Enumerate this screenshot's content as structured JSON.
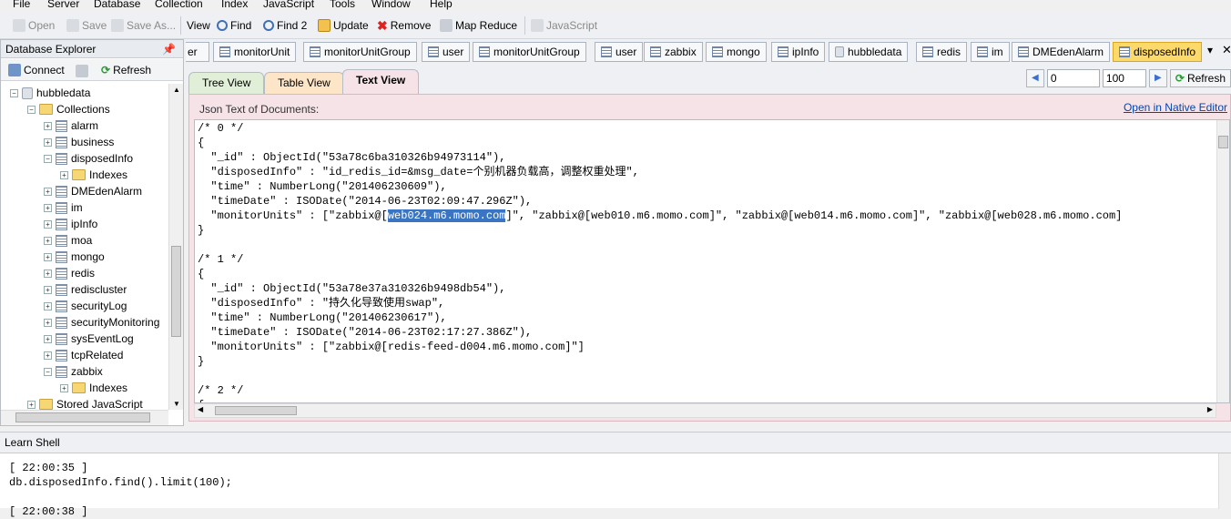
{
  "menu": [
    "File",
    "Server",
    "Database",
    "Collection",
    "Index",
    "JavaScript",
    "Tools",
    "Window",
    "Help"
  ],
  "toolbar": {
    "open": "Open",
    "save": "Save",
    "save_as": "Save As...",
    "view": "View",
    "find": "Find",
    "find2": "Find 2",
    "update": "Update",
    "remove": "Remove",
    "map_reduce": "Map Reduce",
    "javascript": "JavaScript"
  },
  "explorer": {
    "title": "Database Explorer",
    "connect": "Connect",
    "refresh": "Refresh",
    "tree": {
      "db": "hubbledata",
      "collections_label": "Collections",
      "items": [
        "alarm",
        "business",
        "disposedInfo",
        "Indexes",
        "DMEdenAlarm",
        "im",
        "ipInfo",
        "moa",
        "mongo",
        "redis",
        "rediscluster",
        "securityLog",
        "securityMonitoring",
        "sysEventLog",
        "tcpRelated",
        "zabbix",
        "Indexes"
      ],
      "stored_js": "Stored JavaScript"
    }
  },
  "doc_tabs": [
    "er",
    "monitorUnit",
    "monitorUnitGroup",
    "user",
    "monitorUnitGroup",
    "user",
    "zabbix",
    "mongo",
    "ipInfo",
    "hubbledata",
    "redis",
    "im",
    "DMEdenAlarm",
    "disposedInfo"
  ],
  "view_tabs": {
    "tree": "Tree View",
    "table": "Table View",
    "text": "Text View"
  },
  "pager": {
    "skip": "0",
    "limit": "100",
    "refresh": "Refresh"
  },
  "text_panel": {
    "label": "Json Text of Documents:",
    "native_link": "Open in Native Editor",
    "lines": [
      "/* 0 */",
      "{",
      "  \"_id\" : ObjectId(\"53a78c6ba310326b94973114\"),",
      "  \"disposedInfo\" : \"id_redis_id=&msg_date=个别机器负载高，调整权重处理\",",
      "  \"time\" : NumberLong(\"201406230609\"),",
      "  \"timeDate\" : ISODate(\"2014-06-23T02:09:47.296Z\"),",
      "  \"monitorUnits\" : [\"zabbix@[",
      "}",
      "",
      "/* 1 */",
      "{",
      "  \"_id\" : ObjectId(\"53a78e37a310326b9498db54\"),",
      "  \"disposedInfo\" : \"持久化导致使用swap\",",
      "  \"time\" : NumberLong(\"201406230617\"),",
      "  \"timeDate\" : ISODate(\"2014-06-23T02:17:27.386Z\"),",
      "  \"monitorUnits\" : [\"zabbix@[redis-feed-d004.m6.momo.com]\"]",
      "}",
      "",
      "/* 2 */",
      "{"
    ],
    "selected_text": "web024.m6.momo.com",
    "line6_rest": "]\", \"zabbix@[web010.m6.momo.com]\", \"zabbix@[web014.m6.momo.com]\", \"zabbix@[web028.m6.momo.com]"
  },
  "shell": {
    "title": "Learn Shell",
    "lines": [
      "[ 22:00:35 ]",
      "db.disposedInfo.find().limit(100);",
      "",
      "[ 22:00:38 ]"
    ]
  }
}
